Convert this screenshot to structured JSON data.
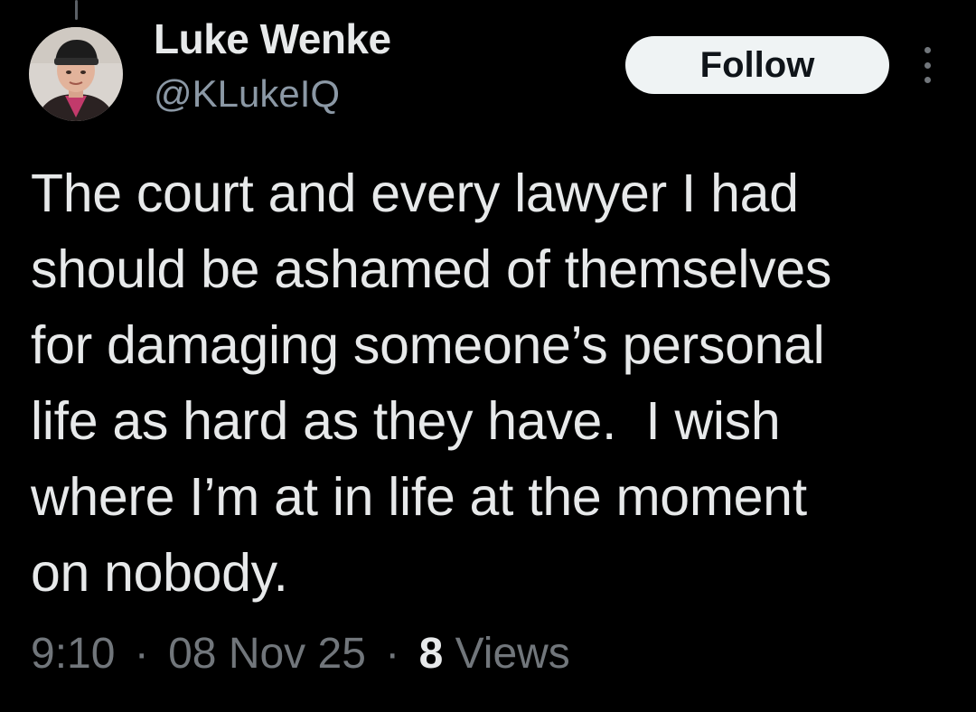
{
  "user": {
    "display_name": "Luke Wenke",
    "handle": "@KLukeIQ"
  },
  "actions": {
    "follow_label": "Follow"
  },
  "tweet": {
    "text": "The court and every lawyer I had\nshould be ashamed of themselves\nfor damaging someone’s personal\nlife as hard as they have.  I wish\nwhere I’m at in life at the moment\non nobody."
  },
  "meta": {
    "time": "9:10",
    "separator": "·",
    "date": "08 Nov 25",
    "views_count": "8",
    "views_label": "Views"
  },
  "colors": {
    "background": "#000000",
    "primary_text": "#e7e9ea",
    "secondary_text": "#71767b",
    "follow_button_bg": "#eff3f4"
  },
  "icons": {
    "more": "more-vertical-icon"
  }
}
